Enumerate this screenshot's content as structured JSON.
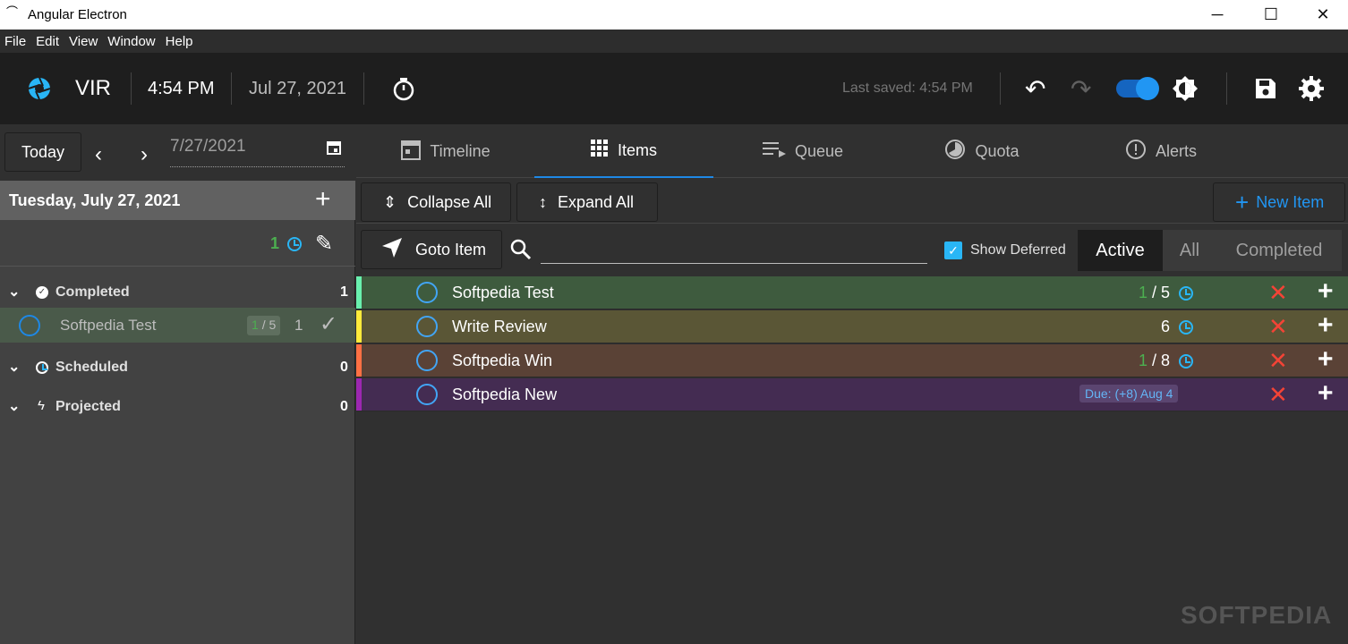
{
  "window": {
    "title": "Angular Electron",
    "minimize": "─",
    "maximize": "☐",
    "close": "✕"
  },
  "menu": [
    "File",
    "Edit",
    "View",
    "Window",
    "Help"
  ],
  "header": {
    "app_name": "VIR",
    "time": "4:54 PM",
    "date": "Jul 27, 2021",
    "last_saved": "Last saved: 4:54 PM",
    "accent": "#1e88e5"
  },
  "sidebar": {
    "today_label": "Today",
    "date_value": "7/27/2021",
    "day_title": "Tuesday, July 27, 2021",
    "summary_count": "1",
    "groups": [
      {
        "label": "Completed",
        "count": "1"
      },
      {
        "label": "Scheduled",
        "count": "0"
      },
      {
        "label": "Projected",
        "count": "0"
      }
    ],
    "completed_item": {
      "label": "Softpedia Test",
      "progress_done": "1",
      "progress_total": "/ 5",
      "count": "1"
    }
  },
  "tabs": [
    {
      "label": "Timeline",
      "icon": "calendar-icon"
    },
    {
      "label": "Items",
      "icon": "grid-icon"
    },
    {
      "label": "Queue",
      "icon": "queue-icon"
    },
    {
      "label": "Quota",
      "icon": "quota-icon"
    },
    {
      "label": "Alerts",
      "icon": "alert-icon"
    }
  ],
  "toolbar": {
    "collapse_all": "Collapse All",
    "expand_all": "Expand All",
    "new_item": "New Item",
    "goto_item": "Goto Item",
    "show_deferred": "Show Deferred",
    "filters": [
      "Active",
      "All",
      "Completed"
    ],
    "search_placeholder": ""
  },
  "items": [
    {
      "label": "Softpedia Test",
      "done": "1",
      "total": "/ 5",
      "color": "#69f0ae",
      "bg": "#3e5b3e",
      "extra": ""
    },
    {
      "label": "Write Review",
      "done": "",
      "total": "6",
      "color": "#ffeb3b",
      "bg": "#5a5636",
      "extra": ""
    },
    {
      "label": "Softpedia Win",
      "done": "1",
      "total": "/ 8",
      "color": "#ff7043",
      "bg": "#5a4236",
      "extra": ""
    },
    {
      "label": "Softpedia New",
      "done": "",
      "total": "",
      "color": "#9c27b0",
      "bg": "#442c52",
      "extra": "Due: (+8) Aug 4"
    }
  ],
  "watermark": "SOFTPEDIA"
}
